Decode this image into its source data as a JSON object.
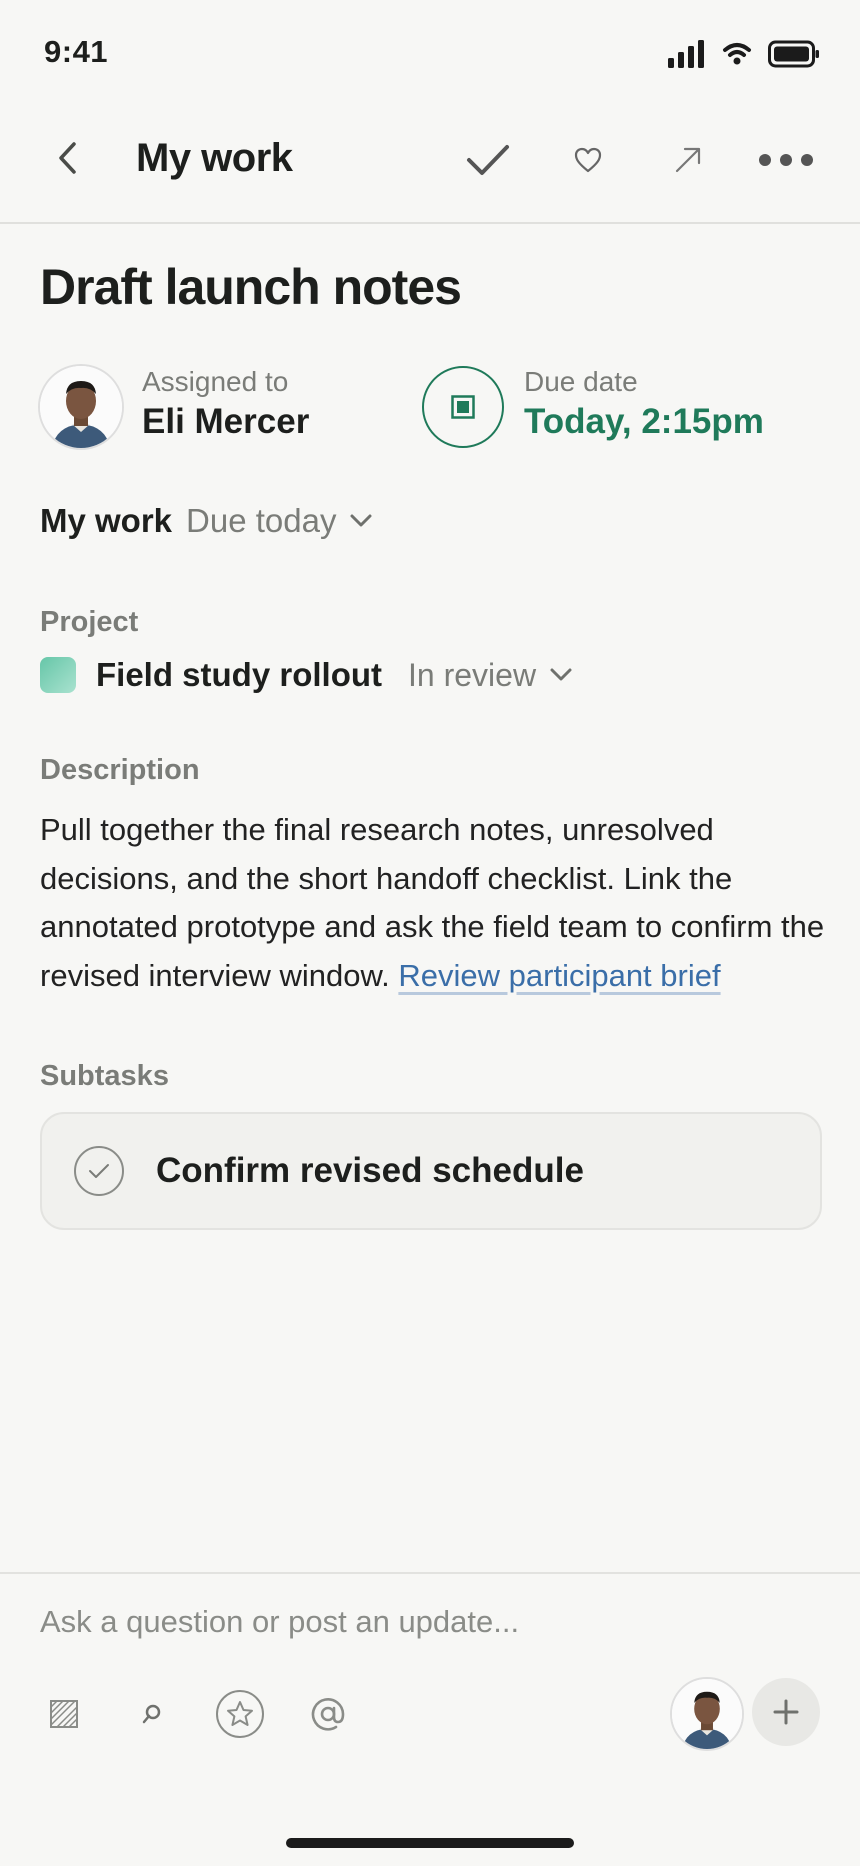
{
  "status_bar": {
    "time": "9:41"
  },
  "header": {
    "title": "My work"
  },
  "task": {
    "title": "Draft launch notes"
  },
  "assignee": {
    "label": "Assigned to",
    "name": "Eli Mercer"
  },
  "due": {
    "label": "Due date",
    "value": "Today, 2:15pm"
  },
  "section": {
    "name": "My work",
    "filter": "Due today"
  },
  "project": {
    "label": "Project",
    "name": "Field study rollout",
    "status": "In review"
  },
  "description": {
    "label": "Description",
    "text": "Pull together the final research notes, unresolved decisions, and the short handoff checklist. Link the annotated prototype and ask the field team to confirm the revised interview window. ",
    "link": "Review participant brief"
  },
  "subtasks": {
    "label": "Subtasks",
    "items": [
      {
        "title": "Confirm revised schedule"
      }
    ]
  },
  "composer": {
    "placeholder": "Ask a question or post an update..."
  },
  "colors": {
    "accent": "#1f7a5a",
    "link": "#3a6ea8",
    "background": "#f7f7f5"
  },
  "icons": [
    "back-icon",
    "check-icon",
    "heart-icon",
    "share-arrow-icon",
    "more-icon",
    "stop-icon",
    "chevron-down-icon",
    "attachment-icon",
    "search-icon",
    "star-icon",
    "mention-icon",
    "plus-icon"
  ]
}
